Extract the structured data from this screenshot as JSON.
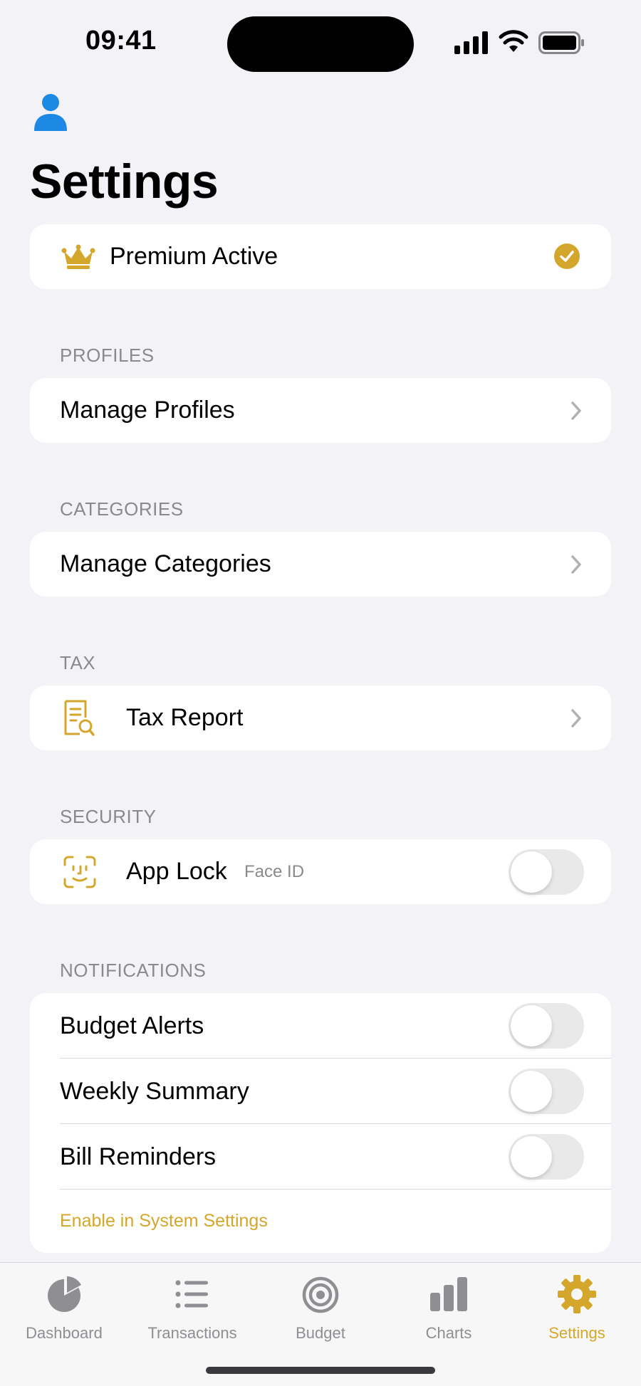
{
  "status_bar": {
    "time": "09:41"
  },
  "page": {
    "title": "Settings"
  },
  "premium": {
    "label": "Premium Active"
  },
  "sections": {
    "profiles": {
      "header": "PROFILES",
      "row_label": "Manage Profiles"
    },
    "categories": {
      "header": "CATEGORIES",
      "row_label": "Manage Categories"
    },
    "tax": {
      "header": "TAX",
      "row_label": "Tax Report"
    },
    "security": {
      "header": "SECURITY",
      "row_label": "App Lock",
      "row_detail": "Face ID",
      "toggle_on": false
    },
    "notifications": {
      "header": "NOTIFICATIONS",
      "items": [
        {
          "label": "Budget Alerts",
          "toggle_on": false
        },
        {
          "label": "Weekly Summary",
          "toggle_on": false
        },
        {
          "label": "Bill Reminders",
          "toggle_on": false
        }
      ],
      "footer_link": "Enable in System Settings"
    }
  },
  "tabbar": {
    "tabs": [
      {
        "label": "Dashboard",
        "icon": "pie-chart-icon"
      },
      {
        "label": "Transactions",
        "icon": "list-icon"
      },
      {
        "label": "Budget",
        "icon": "target-icon"
      },
      {
        "label": "Charts",
        "icon": "bar-chart-icon"
      },
      {
        "label": "Settings",
        "icon": "gear-icon"
      }
    ],
    "active_index": 4
  },
  "colors": {
    "accent": "#D4A72C",
    "profile_blue": "#1E88E5",
    "background": "#F2F2F7"
  }
}
